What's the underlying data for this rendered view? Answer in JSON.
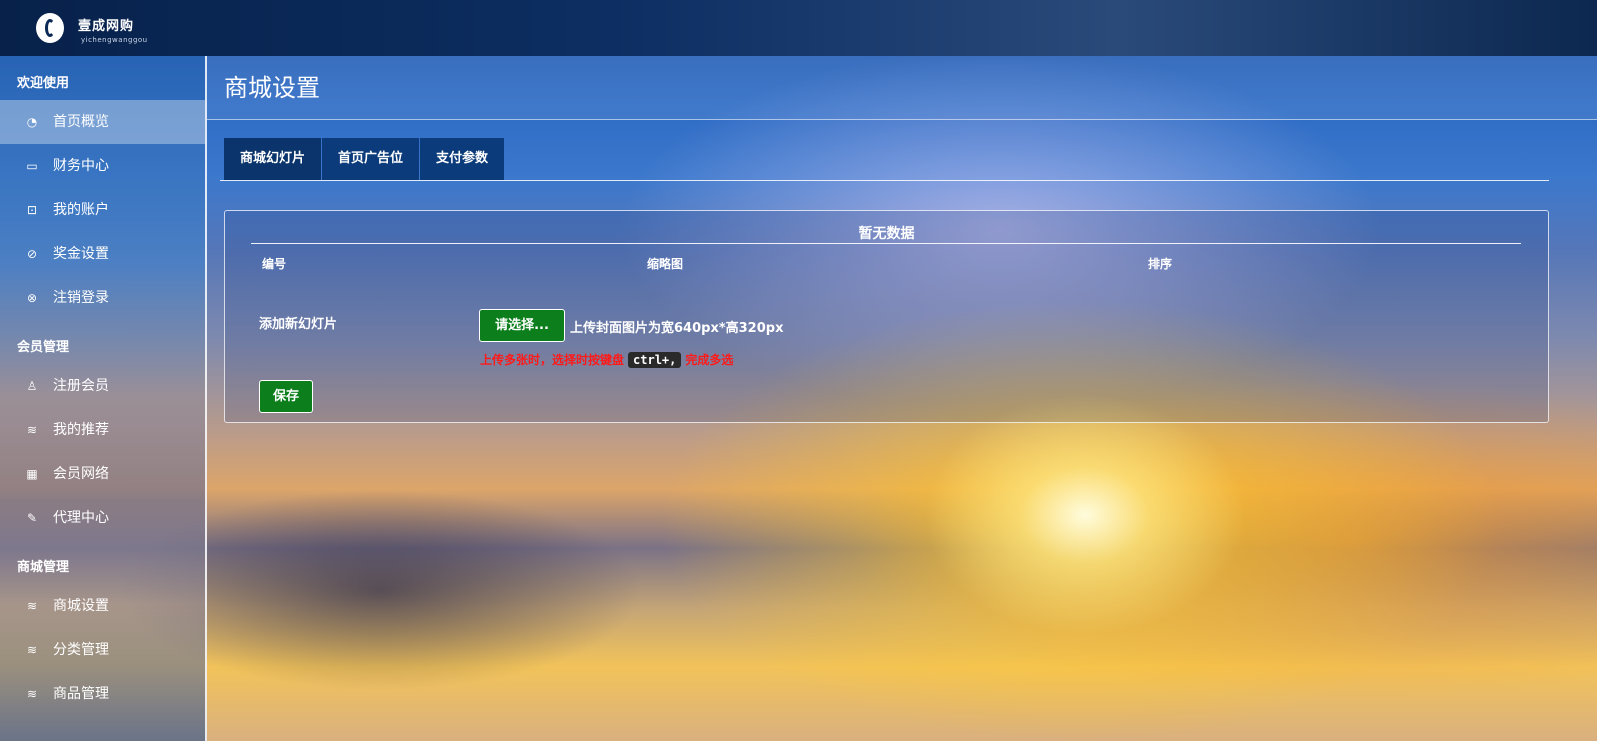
{
  "brand": {
    "name": "壹成网购",
    "sub": "yichengwanggou"
  },
  "sidebar": {
    "sections": [
      {
        "title": "欢迎使用",
        "items": [
          {
            "label": "首页概览",
            "icon": "dashboard-icon",
            "glyph": "◔"
          },
          {
            "label": "财务中心",
            "icon": "folder-icon",
            "glyph": "▭"
          },
          {
            "label": "我的账户",
            "icon": "lock-icon",
            "glyph": "⊡"
          },
          {
            "label": "奖金设置",
            "icon": "compass-icon",
            "glyph": "⊘"
          },
          {
            "label": "注销登录",
            "icon": "close-circle-icon",
            "glyph": "⊗"
          }
        ]
      },
      {
        "title": "会员管理",
        "items": [
          {
            "label": "注册会员",
            "icon": "user-icon",
            "glyph": "♙"
          },
          {
            "label": "我的推荐",
            "icon": "layers-icon",
            "glyph": "≋"
          },
          {
            "label": "会员网络",
            "icon": "grid-icon",
            "glyph": "▦"
          },
          {
            "label": "代理中心",
            "icon": "pencil-icon",
            "glyph": "✎"
          }
        ]
      },
      {
        "title": "商城管理",
        "items": [
          {
            "label": "商城设置",
            "icon": "layers-icon",
            "glyph": "≋"
          },
          {
            "label": "分类管理",
            "icon": "layers-icon",
            "glyph": "≋"
          },
          {
            "label": "商品管理",
            "icon": "layers-icon",
            "glyph": "≋"
          }
        ]
      }
    ],
    "active": "首页概览"
  },
  "page": {
    "title": "商城设置"
  },
  "tabs": [
    "商城幻灯片",
    "首页广告位",
    "支付参数"
  ],
  "panel": {
    "empty_text": "暂无数据",
    "columns": [
      "编号",
      "缩略图",
      "排序"
    ],
    "add_label": "添加新幻灯片",
    "choose_button": "请选择...",
    "upload_hint": "上传封面图片为宽640px*高320px",
    "warning_before": "上传多张时，选择时按键盘",
    "warning_key": "ctrl+,",
    "warning_after": "完成多选",
    "save_button": "保存"
  },
  "colors": {
    "button_green": "#0c7f1c",
    "warning_red": "#ff1a1a",
    "tab_bg": "#0b3b7a"
  }
}
